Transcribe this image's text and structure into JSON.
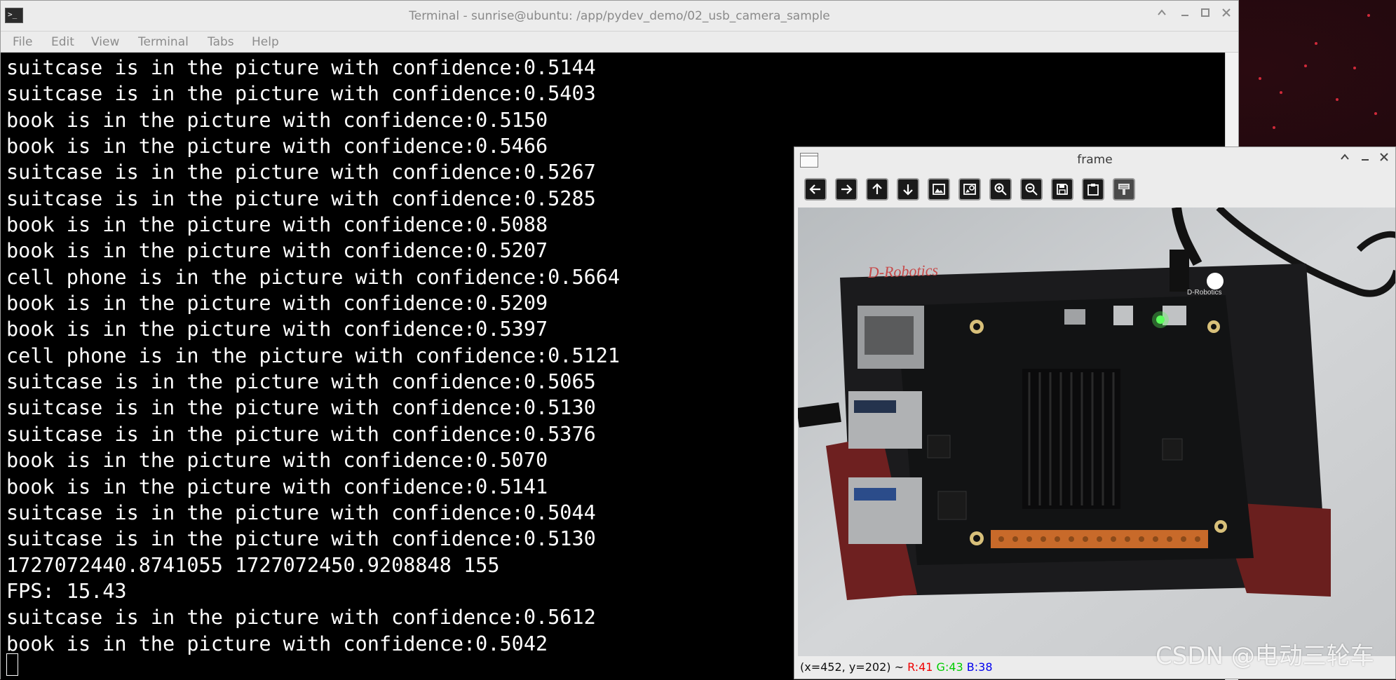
{
  "terminal": {
    "title": "Terminal - sunrise@ubuntu: /app/pydev_demo/02_usb_camera_sample",
    "prompt_icon": ">_",
    "menu": [
      "File",
      "Edit",
      "View",
      "Terminal",
      "Tabs",
      "Help"
    ],
    "lines": [
      "suitcase is in the picture with confidence:0.5144",
      "suitcase is in the picture with confidence:0.5403",
      "book is in the picture with confidence:0.5150",
      "book is in the picture with confidence:0.5466",
      "suitcase is in the picture with confidence:0.5267",
      "suitcase is in the picture with confidence:0.5285",
      "book is in the picture with confidence:0.5088",
      "book is in the picture with confidence:0.5207",
      "cell phone is in the picture with confidence:0.5664",
      "book is in the picture with confidence:0.5209",
      "book is in the picture with confidence:0.5397",
      "cell phone is in the picture with confidence:0.5121",
      "suitcase is in the picture with confidence:0.5065",
      "suitcase is in the picture with confidence:0.5130",
      "suitcase is in the picture with confidence:0.5376",
      "book is in the picture with confidence:0.5070",
      "book is in the picture with confidence:0.5141",
      "suitcase is in the picture with confidence:0.5044",
      "suitcase is in the picture with confidence:0.5130",
      "1727072440.8741055 1727072450.9208848 155",
      "FPS: 15.43",
      "suitcase is in the picture with confidence:0.5612",
      "book is in the picture with confidence:0.5042"
    ]
  },
  "frame_window": {
    "title": "frame",
    "toolbar": [
      "arrow-left-icon",
      "arrow-right-icon",
      "arrow-up-icon",
      "arrow-down-icon",
      "image-icon",
      "image-settings-icon",
      "zoom-in-icon",
      "zoom-out-icon",
      "save-icon",
      "clipboard-icon",
      "properties-icon"
    ],
    "image": {
      "board_brand": "D-Robotics",
      "board_brand_small": "D-Robotics"
    },
    "status": {
      "coords": "(x=452, y=202) ~",
      "r": "R:41",
      "g": "G:43",
      "b": "B:38",
      "colors": {
        "r": "#ee0000",
        "g": "#00cc00",
        "b": "#0000ee"
      }
    }
  },
  "watermark": "CSDN @电动三轮车"
}
